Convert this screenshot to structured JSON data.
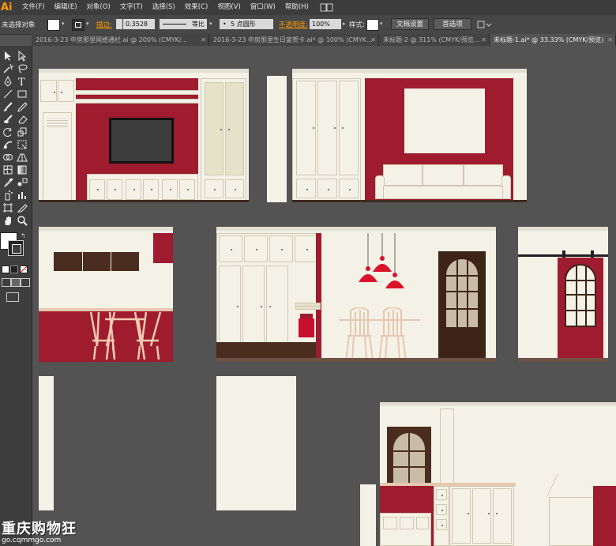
{
  "app": {
    "logo": "Ai"
  },
  "menu": [
    "文件(F)",
    "编辑(E)",
    "对象(O)",
    "文字(T)",
    "选择(S)",
    "效果(C)",
    "视图(V)",
    "窗口(W)",
    "帮助(H)"
  ],
  "control_bar": {
    "selection_label": "未选择对象",
    "stroke_label": "描边:",
    "stroke_value": "0.3528",
    "line_style": "等比",
    "brush": "5 点圆形",
    "opacity_label": "不透明度:",
    "opacity_value": "100%",
    "style_label": "样式:",
    "doc_settings": "文档设置",
    "preferences": "首选项"
  },
  "tabs": [
    {
      "label": "2016-3-23 中房那里网络通栏.ai @ 200% (CMYK/...",
      "active": false
    },
    {
      "label": "2016-3-23 中房那里生日宴贺卡.ai* @ 100% (CMYK...",
      "active": false
    },
    {
      "label": "未标题-2 @ 311% (CMYK/预览...",
      "active": false
    },
    {
      "label": "未标题-1.ai* @ 33.33% (CMYK/预览)",
      "active": true
    }
  ],
  "tools": [
    "selection-tool",
    "direct-selection-tool",
    "magic-wand-tool",
    "lasso-tool",
    "pen-tool",
    "type-tool",
    "line-tool",
    "rectangle-tool",
    "paintbrush-tool",
    "pencil-tool",
    "blob-brush-tool",
    "eraser-tool",
    "rotate-tool",
    "scale-tool",
    "warp-tool",
    "free-transform-tool",
    "shape-builder-tool",
    "perspective-tool",
    "mesh-tool",
    "gradient-tool",
    "eyedropper-tool",
    "blend-tool",
    "symbol-sprayer-tool",
    "column-graph-tool",
    "artboard-tool",
    "slice-tool",
    "hand-tool",
    "zoom-tool"
  ],
  "colors": {
    "accent_red": "#9e1c2d",
    "cream": "#f4f1e6",
    "dark_brown": "#4a2d1e",
    "pendant_red": "#d8142a",
    "canvas": "#535353"
  },
  "watermark": {
    "title": "重庆购物狂",
    "url": "go.cqmmgo.com"
  }
}
